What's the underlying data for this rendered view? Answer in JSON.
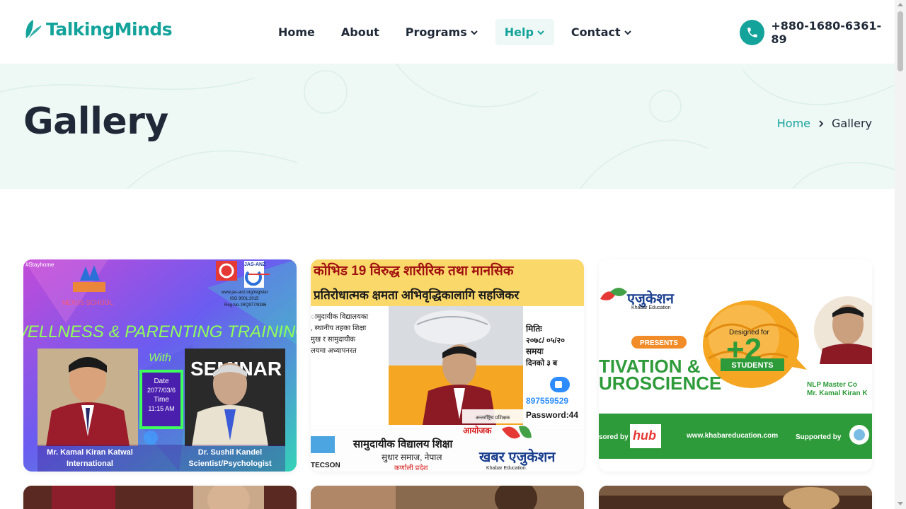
{
  "brand": {
    "name": "TalkingMinds",
    "color": "#13a39a"
  },
  "nav": {
    "items": [
      {
        "label": "Home"
      },
      {
        "label": "About"
      },
      {
        "label": "Programs"
      },
      {
        "label": "Help"
      },
      {
        "label": "Contact"
      }
    ],
    "active": "Help"
  },
  "contact": {
    "phone": "+880-1680-6361-89",
    "icon": "phone-icon"
  },
  "banner": {
    "title": "Gallery"
  },
  "breadcrumb": {
    "home": "Home",
    "current": "Gallery"
  },
  "gallery": {
    "card1": {
      "tag": "#Stayhome",
      "school": "NEXUS SCHOOL",
      "title": "WELLNESS & PARENTING TRAINING",
      "with": "With",
      "date_label": "Date",
      "date": "2077/03/6",
      "time_label": "Time",
      "time": "11:15 AM",
      "register": "www.jas-anz.org/register",
      "iso": "ISO 9001:2015",
      "reg": "Reg.No.:IRQ977/8386",
      "accreditation": "JAS-ANZ",
      "seminar": "SEMINAR",
      "speaker1": "Mr. Kamal Kiran Katwal",
      "speaker1_role": "International",
      "speaker2": "Dr. Sushil Kandel",
      "speaker2_role": "Scientist/Psychologist"
    },
    "card2": {
      "headline1": "कोभिड 19 विरुद्ध शारीरिक तथा मानसिक",
      "headline2": "प्रतिरोधात्मक क्षमता अभिवृद्धिकालागि सहजिकर",
      "date_label": "मितिः",
      "date": "२०७८/ ०५/२०",
      "time_label": "समयः",
      "time": "दिनको ३ ब",
      "meeting_id": "897559529",
      "password": "Password:44",
      "trainer_caption": "अन्तर्राष्ट्रिय प्रशिक्षक",
      "organizer": "आयोजक",
      "org_line1": "सामुदायीक विद्यालय शिक्षा",
      "org_line2": "सुधार समाज, नेपाल",
      "province": "कर्णाली प्रदेश",
      "logo": "खबर एजुकेशन",
      "logo_sub": "Khabar Education",
      "tecson": "TECSON"
    },
    "card3": {
      "logo": "एजुकेशन",
      "logo_sub": "Khabar Education",
      "presents": "PRESENTS",
      "designed_for": "Designed for",
      "plus2": "+2",
      "students": "STUDENTS",
      "title1": "TIVATION &",
      "title2": "UROSCIENCE",
      "trainer_title": "NLP Master Co",
      "trainer_name": "Mr. Kamal Kiran K",
      "sponsored": "sored by",
      "hub": "hub",
      "website": "www.khabareducation.com",
      "supported": "Supported by"
    }
  }
}
